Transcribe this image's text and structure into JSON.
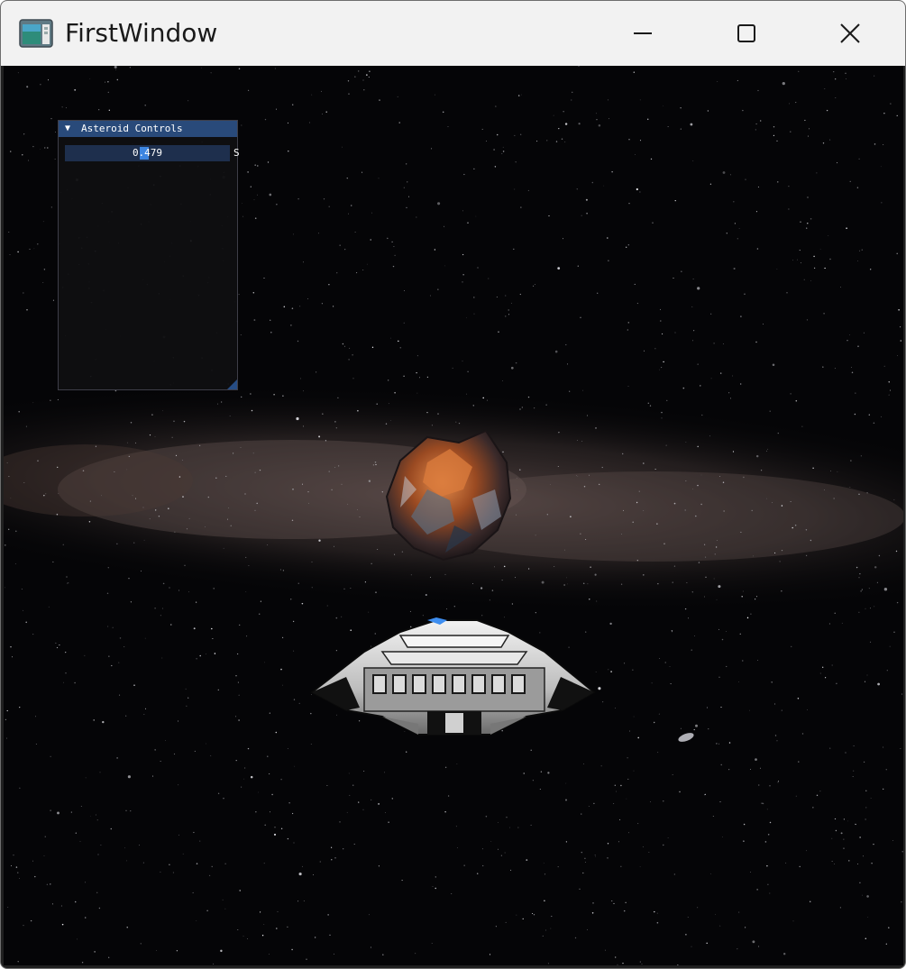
{
  "window": {
    "title": "FirstWindow",
    "app_icon": "app-window-icon",
    "minimize_icon": "minimize-icon",
    "maximize_icon": "maximize-icon",
    "close_icon": "close-icon"
  },
  "imgui": {
    "panel_title": "Asteroid Controls",
    "collapse_arrow": "▼",
    "slider_value": "0.479",
    "slider_fraction": 0.479,
    "slider_label": "Speed",
    "colors": {
      "title_bg": "#294a7a",
      "slider_bg": "#1e2f4d",
      "slider_grab": "#3d85e0"
    }
  },
  "scene": {
    "background": "starfield with milky way band",
    "objects": [
      "asteroid",
      "spaceship"
    ],
    "asteroid_color": "#b5582a",
    "ship_color": "#c8c8c8"
  }
}
